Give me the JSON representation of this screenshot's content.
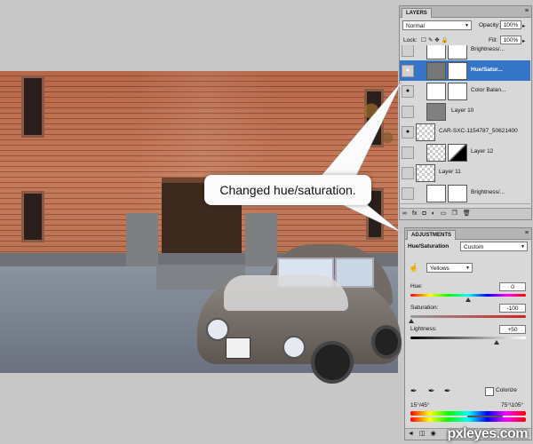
{
  "callout": {
    "text": "Changed hue/saturation."
  },
  "layers_panel": {
    "tab": "LAYERS",
    "blend_mode": "Normal",
    "opacity_label": "Opacity:",
    "opacity_value": "100%",
    "lock_label": "Lock:",
    "fill_label": "Fill:",
    "fill_value": "100%",
    "layers": [
      {
        "name": "Brightness/...",
        "visible": false,
        "active": false
      },
      {
        "name": "Hue/Satur...",
        "visible": true,
        "active": true
      },
      {
        "name": "Color Balan...",
        "visible": true,
        "active": false
      },
      {
        "name": "Layer 10",
        "visible": false,
        "active": false
      },
      {
        "name": "CAR-SXC-1154787_50621400",
        "visible": true,
        "active": false
      },
      {
        "name": "Layer 12",
        "visible": false,
        "active": false
      },
      {
        "name": "Layer 11",
        "visible": false,
        "active": false
      },
      {
        "name": "Brightness/...",
        "visible": false,
        "active": false
      }
    ],
    "footer_icons": [
      "link-icon",
      "fx-icon",
      "mask-icon",
      "adjustment-icon",
      "folder-icon",
      "new-layer-icon",
      "trash-icon"
    ]
  },
  "adjustments_panel": {
    "tab": "ADJUSTMENTS",
    "title": "Hue/Saturation",
    "preset": "Custom",
    "channel": "Yellows",
    "hue_label": "Hue:",
    "hue_value": "0",
    "saturation_label": "Saturation:",
    "saturation_value": "-100",
    "lightness_label": "Lightness:",
    "lightness_value": "+50",
    "colorize_label": "Colorize",
    "colorize_checked": false,
    "range_left": "15°/45°",
    "range_right": "75°\\105°"
  },
  "watermark": "pxleyes.com"
}
